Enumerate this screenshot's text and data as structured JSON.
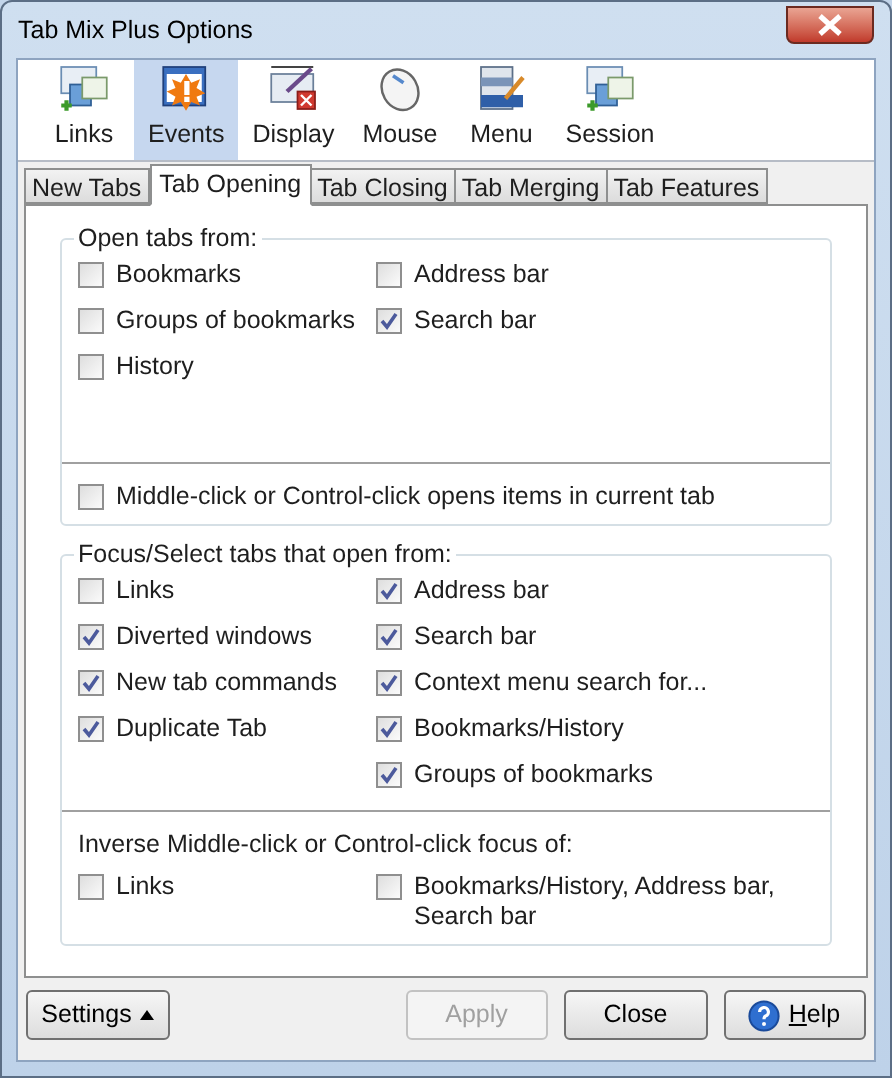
{
  "window": {
    "title": "Tab Mix Plus Options"
  },
  "toolbar": [
    {
      "label": "Links",
      "selected": false
    },
    {
      "label": "Events",
      "selected": true
    },
    {
      "label": "Display",
      "selected": false
    },
    {
      "label": "Mouse",
      "selected": false
    },
    {
      "label": "Menu",
      "selected": false
    },
    {
      "label": "Session",
      "selected": false
    }
  ],
  "tabs": [
    {
      "label": "New Tabs",
      "selected": false
    },
    {
      "label": "Tab Opening",
      "selected": true
    },
    {
      "label": "Tab Closing",
      "selected": false
    },
    {
      "label": "Tab Merging",
      "selected": false
    },
    {
      "label": "Tab Features",
      "selected": false
    }
  ],
  "groups": [
    {
      "legend": "Open tabs from:",
      "sections": [
        {
          "columns": [
            [
              {
                "label": "Bookmarks",
                "checked": false
              },
              {
                "label": "Groups of bookmarks",
                "checked": false
              },
              {
                "label": "History",
                "checked": false
              }
            ],
            [
              {
                "label": "Address bar",
                "checked": false
              },
              {
                "label": "Search bar",
                "checked": true
              }
            ]
          ]
        },
        {
          "columns": [
            [
              {
                "label": "Middle-click or Control-click opens items in current tab",
                "checked": false
              }
            ]
          ]
        }
      ]
    },
    {
      "legend": "Focus/Select tabs that open from:",
      "sections": [
        {
          "columns": [
            [
              {
                "label": "Links",
                "checked": false
              },
              {
                "label": "Diverted windows",
                "checked": true
              },
              {
                "label": "New tab commands",
                "checked": true
              },
              {
                "label": "Duplicate Tab",
                "checked": true
              }
            ],
            [
              {
                "label": "Address bar",
                "checked": true
              },
              {
                "label": "Search bar",
                "checked": true
              },
              {
                "label": "Context menu search for...",
                "checked": true
              },
              {
                "label": "Bookmarks/History",
                "checked": true
              },
              {
                "label": "Groups of bookmarks",
                "checked": true
              }
            ]
          ]
        },
        {
          "heading": "Inverse Middle-click or Control-click focus of:",
          "columns": [
            [
              {
                "label": "Links",
                "checked": false
              }
            ],
            [
              {
                "label": "Bookmarks/History, Address bar, Search bar",
                "checked": false
              }
            ]
          ]
        }
      ]
    }
  ],
  "buttons": [
    {
      "label": "Settings",
      "kind": "menu",
      "disabled": false
    },
    {
      "label": "Apply",
      "kind": "plain",
      "disabled": true
    },
    {
      "label": "Close",
      "kind": "plain",
      "disabled": false
    },
    {
      "label": "Help",
      "kind": "help",
      "disabled": false
    }
  ]
}
